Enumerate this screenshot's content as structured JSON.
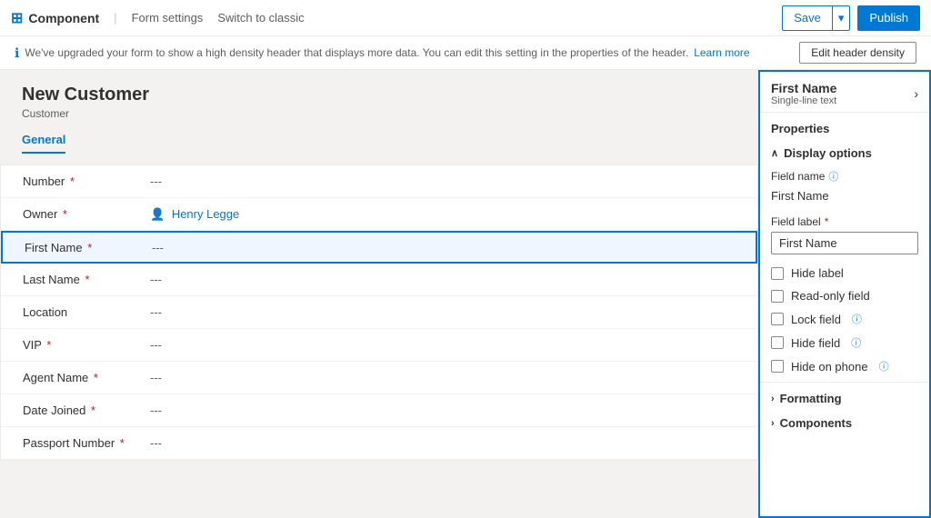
{
  "topbar": {
    "logo_label": "Component",
    "form_settings_label": "Form settings",
    "switch_label": "Switch to classic",
    "save_label": "Save",
    "publish_label": "Publish"
  },
  "infobar": {
    "message": "We've upgraded your form to show a high density header that displays more data. You can edit this setting in the properties of the header.",
    "link_text": "Learn more",
    "edit_button": "Edit header density"
  },
  "form": {
    "title": "New Customer",
    "subtitle": "Customer",
    "tab": "General",
    "fields": [
      {
        "label": "Number",
        "required": true,
        "value": "---",
        "type": "normal"
      },
      {
        "label": "Owner",
        "required": true,
        "value": "Henry Legge",
        "type": "owner"
      },
      {
        "label": "First Name",
        "required": true,
        "value": "---",
        "type": "selected"
      },
      {
        "label": "Last Name",
        "required": true,
        "value": "---",
        "type": "normal"
      },
      {
        "label": "Location",
        "required": false,
        "value": "---",
        "type": "normal"
      },
      {
        "label": "VIP",
        "required": true,
        "value": "---",
        "type": "normal"
      },
      {
        "label": "Agent Name",
        "required": true,
        "value": "---",
        "type": "normal"
      },
      {
        "label": "Date Joined",
        "required": true,
        "value": "---",
        "type": "normal"
      },
      {
        "label": "Passport Number",
        "required": true,
        "value": "---",
        "type": "normal"
      }
    ]
  },
  "panel": {
    "field_name": "First Name",
    "field_type": "Single-line text",
    "properties_label": "Properties",
    "chevron_symbol": "›",
    "display_options_label": "Display options",
    "field_name_label": "Field name",
    "field_name_info": "ⓘ",
    "field_name_value": "First Name",
    "field_label_label": "Field label",
    "field_label_required": "*",
    "field_label_placeholder": "First Name",
    "checkboxes": [
      {
        "label": "Hide label",
        "checked": false
      },
      {
        "label": "Read-only field",
        "checked": false
      },
      {
        "label": "Lock field",
        "checked": false,
        "has_info": true
      },
      {
        "label": "Hide field",
        "checked": false,
        "has_info": true
      },
      {
        "label": "Hide on phone",
        "checked": false,
        "has_info": true
      }
    ],
    "formatting_label": "Formatting",
    "components_label": "Components"
  },
  "icons": {
    "info": "ℹ",
    "chevron_down": "∨",
    "chevron_right": "›",
    "person": "👤",
    "component": "⊞",
    "form_settings": "📋"
  }
}
